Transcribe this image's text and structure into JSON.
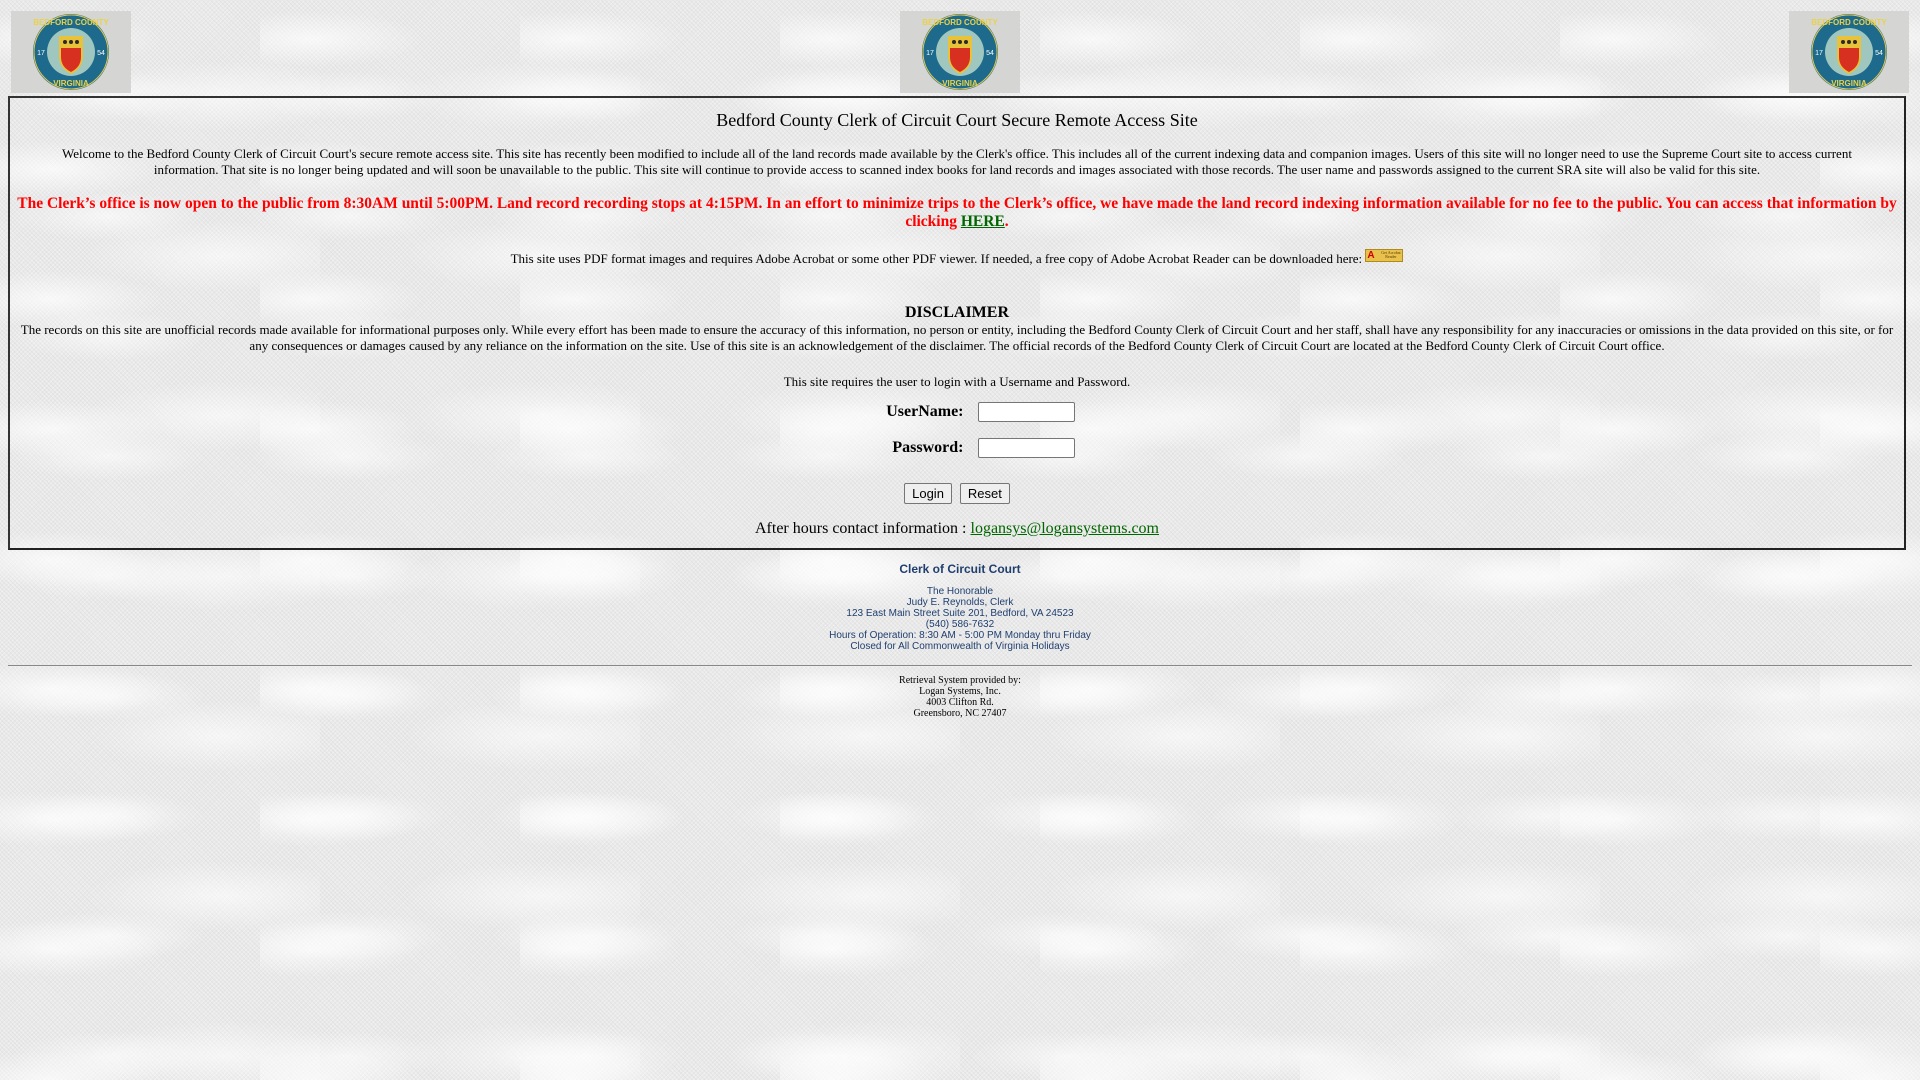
{
  "logos": {
    "alt": "Bedford County Virginia seal",
    "top_text": "BEDFORD COUNTY",
    "bottom_text": "VIRGINIA",
    "year_left": "17",
    "year_right": "54"
  },
  "main": {
    "title": "Bedford County Clerk of Circuit Court Secure Remote Access Site",
    "welcome": "Welcome to the Bedford County Clerk of Circuit Court's secure remote access site.   This site has recently been modified to include all of the land records made available by the Clerk's office. This includes all of the current indexing data and companion images. Users of this site will no longer need to use the Supreme Court site to access current information. That site is no longer being updated and will soon be unavailable to the public. This site will continue to provide access to scanned index books for land records and images associated with those records. The user name and passwords assigned to the current SRA site will also be valid for this site.",
    "notice_text": "The Clerk’s office is now open to the public from 8:30AM until 5:00PM. Land record recording stops at 4:15PM. In an effort to minimize trips to the Clerk’s office, we have made the land record indexing information available for no fee to the public. You can access that information by clicking ",
    "notice_link": "HERE",
    "notice_end": ".",
    "pdf_note": "This site uses PDF format images and requires Adobe Acrobat or some other PDF viewer. If needed, a free copy of Adobe Acrobat Reader can be downloaded here: ",
    "acrobat_icon": {
      "mark": "A",
      "text": "Get Acrobat Reader"
    },
    "disclaimer_title": "DISCLAIMER",
    "disclaimer_text": "The records on this site are unofficial records made available for informational purposes only. While every effort has been made to ensure the accuracy of this information, no person or entity, including the Bedford County Clerk of Circuit Court and her staff, shall have any responsibility for any inaccuracies or omissions in the data provided on this site, or for any consequences or damages caused by any reliance on the information on the site. Use of this site is an acknowledgement of the disclaimer. The official records of the Bedford County Clerk of Circuit Court are located at the Bedford County Clerk of Circuit Court office.",
    "login_prompt": "This site requires the user to login with a Username and Password."
  },
  "login_form": {
    "username_label": "UserName:",
    "username_value": "",
    "password_label": "Password:",
    "password_value": "",
    "login_button": "Login",
    "reset_button": "Reset"
  },
  "contact": {
    "label": "After hours contact information : ",
    "email": "logansys@logansystems.com"
  },
  "clerk": {
    "title": "Clerk of Circuit Court",
    "lines": [
      "The Honorable",
      "Judy E. Reynolds, Clerk",
      "123 East Main Street Suite 201, Bedford, VA 24523",
      "(540) 586-7632",
      "Hours of Operation: 8:30 AM - 5:00 PM Monday thru Friday",
      "Closed for All Commonwealth of Virginia Holidays"
    ]
  },
  "provider": {
    "lines": [
      "Retrieval System provided by:",
      "Logan Systems, Inc.",
      "4003 Clifton Rd.",
      "Greensboro, NC 27407"
    ]
  },
  "colors": {
    "notice_red": "#ff0000",
    "link_green": "#006600",
    "clerk_blue": "#1f3f6f"
  }
}
